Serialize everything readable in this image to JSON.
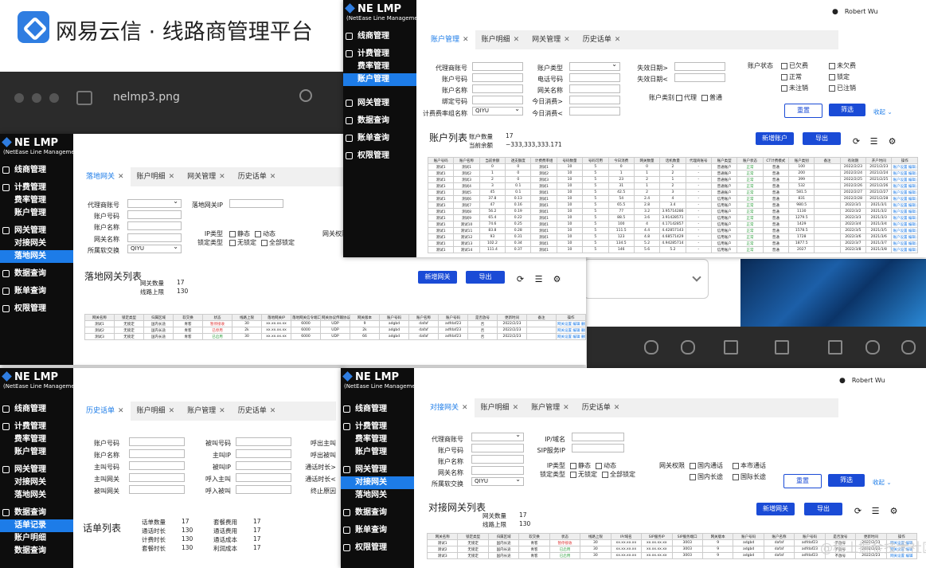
{
  "banner": {
    "text": "网易云信 · 线路商管理平台"
  },
  "mac": {
    "filename": "nelmp3.png"
  },
  "brand": {
    "name": "NE LMP",
    "sub": "(NetEase Line Manageme"
  },
  "user": "Robert Wu",
  "watermark": "@稀土掘金技术社区",
  "menu": {
    "line": "线商管理",
    "billing": "计费管理",
    "rate": "费率管理",
    "account": "账户管理",
    "gateway": "网关管理",
    "access_gw": "对接网关",
    "landing_gw": "落地网关",
    "data": "数据查询",
    "cdr": "话单记录",
    "acct_detail": "账户明细",
    "acct_query": "账单查询",
    "perm": "权限管理",
    "data_short": "数据查询"
  },
  "tabs": {
    "acct_mgmt": "账户管理",
    "acct_detail": "账户明细",
    "gw_mgmt": "网关管理",
    "cdr": "历史话单",
    "landing": "落地网关",
    "access": "对接网关"
  },
  "account_panel": {
    "labels": {
      "agent": "代理商账号",
      "acct_no": "账户号码",
      "acct_name": "账户名称",
      "bind": "绑定号码",
      "rate_group": "计费费率组名称",
      "acct_type": "账户类型",
      "phone": "电话号码",
      "gw_name": "网关名称",
      "today": "今日消费>",
      "today_lt": "今日消费<",
      "expire_gt": "失效日期>",
      "expire_lt": "失效日期<",
      "status": "账户状态",
      "category": "账户类别"
    },
    "rate_value": "QIYU",
    "status_opts": [
      "已欠费",
      "未欠费",
      "正常",
      "锁定",
      "未注销",
      "已注销"
    ],
    "category_opts": [
      "代理",
      "普通"
    ],
    "reset": "重置",
    "filter": "筛选",
    "collapse": "收起",
    "list_title": "账户列表",
    "count_label": "账户数量",
    "count": "17",
    "balance_label": "当前余额",
    "balance": "−333,333,333.171",
    "add": "新增账户",
    "export": "导出",
    "columns": [
      "账户号码",
      "账户名称",
      "当前余额",
      "透支额度",
      "计费费率组",
      "号码数量",
      "号码可用",
      "今日消费",
      "网关数量",
      "话机数量",
      "代理商账号",
      "账户类型",
      "账户状态",
      "CT计费模式",
      "账户类别",
      "备注",
      "有效期",
      "开户时间",
      "操作"
    ],
    "rows": [
      [
        "测试1",
        "测试1",
        "0",
        "0",
        "测试1",
        "10",
        "5",
        "0",
        "0",
        "2",
        "-",
        "普通账户",
        "正常",
        "普通",
        "100",
        "",
        "2022/2/23",
        "2021/2/23",
        "账户设置 编辑 删除"
      ],
      [
        "测试1",
        "测试2",
        "1",
        "0",
        "测试2",
        "10",
        "5",
        "1",
        "1",
        "2",
        "-",
        "普通账户",
        "正常",
        "普通",
        "200",
        "",
        "2022/2/24",
        "2021/2/24",
        "账户设置 编辑 删除"
      ],
      [
        "测试1",
        "测试3",
        "2",
        "0",
        "测试3",
        "10",
        "5",
        "23",
        "2",
        "1",
        "-",
        "普通账户",
        "正常",
        "普通",
        "399",
        "",
        "2022/2/25",
        "2021/2/25",
        "账户设置 编辑 删除"
      ],
      [
        "测试1",
        "测试4",
        "3",
        "0.1",
        "测试1",
        "10",
        "5",
        "31",
        "1",
        "2",
        "-",
        "普通账户",
        "正常",
        "普通",
        "532",
        "",
        "2022/2/26",
        "2021/2/26",
        "账户设置 编辑 删除"
      ],
      [
        "测试1",
        "测试5",
        "45",
        "0.1",
        "测试1",
        "10",
        "5",
        "42.5",
        "2",
        "3",
        "-",
        "普通账户",
        "正常",
        "普通",
        "581.5",
        "",
        "2022/2/27",
        "2021/2/27",
        "账户设置 编辑 删除"
      ],
      [
        "测试1",
        "测试6",
        "37.8",
        "0.13",
        "测试1",
        "10",
        "5",
        "54",
        "2.4",
        "4",
        "-",
        "信用账户",
        "正常",
        "普通",
        "831",
        "",
        "2022/2/28",
        "2021/2/28",
        "账户设置 编辑 删除"
      ],
      [
        "测试1",
        "测试7",
        "47",
        "0.16",
        "测试1",
        "10",
        "5",
        "65.5",
        "2.8",
        "3.4",
        "-",
        "信用账户",
        "正常",
        "普通",
        "980.5",
        "",
        "2022/3/1",
        "2021/3/1",
        "账户设置 编辑 删除"
      ],
      [
        "测试1",
        "测试8",
        "56.2",
        "0.19",
        "测试1",
        "10",
        "5",
        "77",
        "3.2",
        "3.95714286",
        "-",
        "信用账户",
        "正常",
        "普通",
        "1130",
        "",
        "2022/3/2",
        "2021/3/2",
        "账户设置 编辑 删除"
      ],
      [
        "测试1",
        "测试9",
        "65.4",
        "0.22",
        "测试1",
        "10",
        "5",
        "88.5",
        "3.6",
        "3.91428571",
        "-",
        "信用账户",
        "正常",
        "普通",
        "1279.5",
        "",
        "2022/3/3",
        "2021/3/3",
        "账户设置 编辑 删除"
      ],
      [
        "测试1",
        "测试10",
        "74.6",
        "0.25",
        "测试1",
        "10",
        "5",
        "100",
        "4",
        "4.17142857",
        "-",
        "信用账户",
        "正常",
        "普通",
        "1429",
        "",
        "2022/3/4",
        "2021/3/4",
        "账户设置 编辑 删除"
      ],
      [
        "测试1",
        "测试11",
        "83.8",
        "0.28",
        "测试1",
        "10",
        "5",
        "111.5",
        "4.4",
        "4.42857143",
        "-",
        "信用账户",
        "正常",
        "普通",
        "1578.5",
        "",
        "2022/3/5",
        "2021/3/5",
        "账户设置 编辑 删除"
      ],
      [
        "测试1",
        "测试12",
        "93",
        "0.31",
        "测试1",
        "10",
        "5",
        "123",
        "4.8",
        "4.68571429",
        "-",
        "信用账户",
        "正常",
        "普通",
        "1728",
        "",
        "2022/3/6",
        "2021/3/6",
        "账户设置 编辑 删除"
      ],
      [
        "测试1",
        "测试13",
        "102.2",
        "0.34",
        "测试1",
        "10",
        "5",
        "134.5",
        "5.2",
        "4.94285714",
        "-",
        "信用账户",
        "正常",
        "普通",
        "1877.5",
        "",
        "2022/3/7",
        "2021/3/7",
        "账户设置 编辑 删除"
      ],
      [
        "测试1",
        "测试14",
        "111.4",
        "0.37",
        "测试1",
        "10",
        "5",
        "146",
        "5.6",
        "5.2",
        "-",
        "信用账户",
        "正常",
        "普通",
        "2027",
        "",
        "2022/3/8",
        "2021/3/8",
        "账户设置 编辑 删除"
      ]
    ]
  },
  "landing_panel": {
    "labels": {
      "agent": "代理商账号",
      "acct_no": "账户号码",
      "acct_name": "账户名称",
      "gw_name": "网关名称",
      "switch": "所属软交换",
      "ip": "落地网关IP",
      "ip_type": "IP类型",
      "lock_type": "锁定类型",
      "gw_perm": "网关权限"
    },
    "switch_value": "QIYU",
    "ip_opts": [
      "静态",
      "动态"
    ],
    "lock_opts": [
      "无锁定",
      "全部锁定"
    ],
    "list_title": "落地网关列表",
    "count_label": "网关数量",
    "count": "17",
    "line_label": "线路上限",
    "line": "130",
    "add": "新增网关",
    "export": "导出",
    "columns": [
      "网关名称",
      "锁定类型",
      "归属区域",
      "软交换",
      "状态",
      "线路上限",
      "落地网关IP",
      "落地网关信令端口",
      "网关协议传输协议",
      "网关版本",
      "账户号码",
      "账户名称",
      "账户号码",
      "是否放号",
      "更新时间",
      "备注",
      "操作"
    ],
    "rows": [
      [
        "测试1",
        "无锁定",
        "国内长途",
        "青客",
        "暂停接收",
        "30",
        "xx.xx.xx.xx",
        "6000",
        "UDP",
        "9",
        "adgbd",
        "dafaf",
        "adfdaf23",
        "否",
        "2022/2/23",
        "",
        "网关设置 编辑 删除"
      ],
      [
        "测试2",
        "无锁定",
        "国内长途",
        "青客",
        "已停用",
        "2k",
        "xx.xx.xx.xx",
        "6000",
        "UDP",
        "2k",
        "adgbd",
        "dafaf",
        "adfdaf23",
        "否",
        "2022/2/23",
        "",
        "网关设置 编辑 删除"
      ],
      [
        "测试3",
        "无锁定",
        "国内长途",
        "青客",
        "已启用",
        "30",
        "xx.xx.xx.xx",
        "6000",
        "UDP",
        "66",
        "adgbd",
        "dafaf",
        "adfdaf23",
        "否",
        "2022/2/23",
        "",
        "网关设置 编辑 删除"
      ]
    ]
  },
  "cdr_panel": {
    "labels": {
      "acct_no": "账户号码",
      "acct_name": "账户名称",
      "caller": "主叫号码",
      "caller_gw": "主叫网关",
      "callee_gw": "被叫网关",
      "callee": "被叫号码",
      "caller_ip": "主叫IP",
      "callee_ip": "被叫IP",
      "in_caller": "呼入主叫",
      "in_callee": "呼入被叫",
      "out_caller": "呼出主叫",
      "out_callee": "呼出被叫",
      "dur_gt": "通话时长>",
      "dur_lt": "通话时长<",
      "end_reason": "终止原因"
    },
    "list_title": "话单列表",
    "stats": [
      [
        "话单数量",
        "17"
      ],
      [
        "通话时长",
        "130"
      ],
      [
        "计费时长",
        "130"
      ],
      [
        "套餐时长",
        "130"
      ]
    ],
    "stats2": [
      [
        "套餐费用",
        "17"
      ],
      [
        "通话费用",
        "17"
      ],
      [
        "通话成本",
        "17"
      ],
      [
        "利润成本",
        "17"
      ]
    ]
  },
  "access_panel": {
    "labels": {
      "agent": "代理商账号",
      "acct_no": "账户号码",
      "acct_name": "账户名称",
      "gw_name": "网关名称",
      "switch": "所属软交换",
      "ip_domain": "IP/域名",
      "sip_ip": "SIP服务IP",
      "ip_type": "IP类型",
      "lock_type": "锁定类型",
      "gw_perm": "网关权限"
    },
    "switch_value": "QIYU",
    "ip_opts": [
      "静态",
      "动态"
    ],
    "lock_opts": [
      "无锁定",
      "全部锁定"
    ],
    "perm_opts": [
      "国内通话",
      "本市通话",
      "国内长途",
      "国际长途"
    ],
    "reset": "重置",
    "filter": "筛选",
    "collapse": "收起",
    "list_title": "对接网关列表",
    "count_label": "网关数量",
    "count": "17",
    "line_label": "线路上限",
    "line": "130",
    "add": "新增网关",
    "export": "导出",
    "columns": [
      "网关名称",
      "锁定类型",
      "归属区域",
      "软交换",
      "状态",
      "线路上限",
      "IP/域名",
      "SIP服务IP",
      "SIP服务端口",
      "网关版本",
      "账户号码",
      "账户名称",
      "账户号码",
      "是否放号",
      "更新时间",
      "操作"
    ],
    "rows": [
      [
        "测试1",
        "无锁定",
        "国内长途",
        "青客",
        "暂停接收",
        "30",
        "xx.xx.xx.xx",
        "xx.xx.xx.xx",
        "3003",
        "9",
        "adgbd",
        "dafaf",
        "adfdaf23",
        "不放号",
        "2022/2/23",
        "网关设置 编辑"
      ],
      [
        "测试2",
        "无锁定",
        "国内长途",
        "青客",
        "已启用",
        "30",
        "xx.xx.xx.xx",
        "xx.xx.xx.xx",
        "3003",
        "9",
        "adgbd",
        "dafaf",
        "adfdaf23",
        "不放号",
        "2022/2/23",
        "网关设置 编辑"
      ],
      [
        "测试3",
        "无锁定",
        "国内长途",
        "青客",
        "已启用",
        "30",
        "xx.xx.xx.xx",
        "xx.xx.xx.xx",
        "3003",
        "9",
        "adgbd",
        "dafaf",
        "adfdaf23",
        "不放号",
        "2022/2/23",
        "网关设置 编辑"
      ]
    ]
  }
}
